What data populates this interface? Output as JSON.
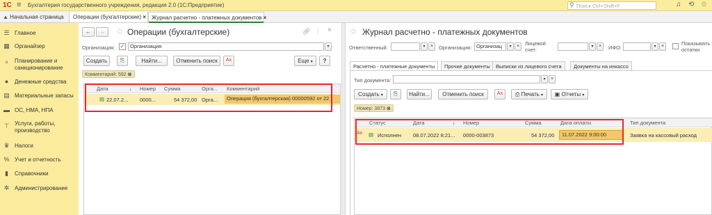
{
  "titlebar": {
    "logo": "1С",
    "app_title": "Бухгалтерия государственного учреждения, редакция 2.0  (1С:Предприятие)",
    "search_placeholder": "Поиск Ctrl+Shift+F"
  },
  "tabs": {
    "home": "Начальная страница",
    "t1": "Операции (бухгалтерские)",
    "t2": "Журнал расчетно - платежных документов"
  },
  "sidebar": {
    "items": [
      {
        "label": "Главное",
        "icon": "menu-icon"
      },
      {
        "label": "Органайзер",
        "icon": "calendar-icon"
      },
      {
        "label": "Планирование и\nсанкционирование",
        "icon": "planning-icon"
      },
      {
        "label": "Денежные средства",
        "icon": "money-icon"
      },
      {
        "label": "Материальные запасы",
        "icon": "warehouse-icon"
      },
      {
        "label": "ОС, НМА, НПА",
        "icon": "truck-icon"
      },
      {
        "label": "Услуги, работы,\nпроизводство",
        "icon": "services-icon"
      },
      {
        "label": "Налоги",
        "icon": "taxes-icon"
      },
      {
        "label": "Учет и отчетность",
        "icon": "reporting-icon"
      },
      {
        "label": "Справочники",
        "icon": "book-icon"
      },
      {
        "label": "Администрирование",
        "icon": "gear-icon"
      }
    ]
  },
  "left": {
    "title": "Операции (бухгалтерские)",
    "org_label": "Организация:",
    "org_value": "Организация",
    "buttons": {
      "create": "Создать",
      "find": "Найти...",
      "cancel_search": "Отменить поиск",
      "more": "Еще",
      "help": "?"
    },
    "filter_chip": "Комментарий: 592",
    "columns": [
      "Дата",
      "Номер",
      "Сумма",
      "Орга...",
      "Комментарий"
    ],
    "row": {
      "date": "22.07.2...",
      "number": "0000...",
      "sum": "54 372,00",
      "org": "Орга...",
      "comment": "Операция (бухгалтерская) 00000592 от 22"
    }
  },
  "right": {
    "title": "Журнал расчетно - платежных документов",
    "responsible_label": "Ответственный:",
    "org_label": "Организация:",
    "org_value": "Организац",
    "account_label": "Лицевой\nсчет:",
    "ifo_label": "ИФО:",
    "show_rest_label": "Показывать\nостатки",
    "subtabs": [
      "Расчетно - платежные документы",
      "Прочие документы",
      "Выписки из лицевого счета",
      "Документы на инкассо"
    ],
    "doctype_label": "Тип документа:",
    "buttons": {
      "create": "Создать",
      "find": "Найти...",
      "cancel_search": "Отменить поиск",
      "print": "Печать",
      "reports": "Отчеты"
    },
    "filter_chip": "Номер: 3873",
    "columns": [
      "Статус",
      "Дата",
      "Номер",
      "Сумма",
      "Дата оплаты",
      "Тип документа"
    ],
    "row": {
      "status": "Исполнен",
      "date": "08.07.2022 8:21...",
      "number": "0000-003873",
      "sum": "54 372,00",
      "pay_date": "11.07.2022 9:00:00",
      "doc_type": "Заявка на кассовый расход"
    }
  }
}
